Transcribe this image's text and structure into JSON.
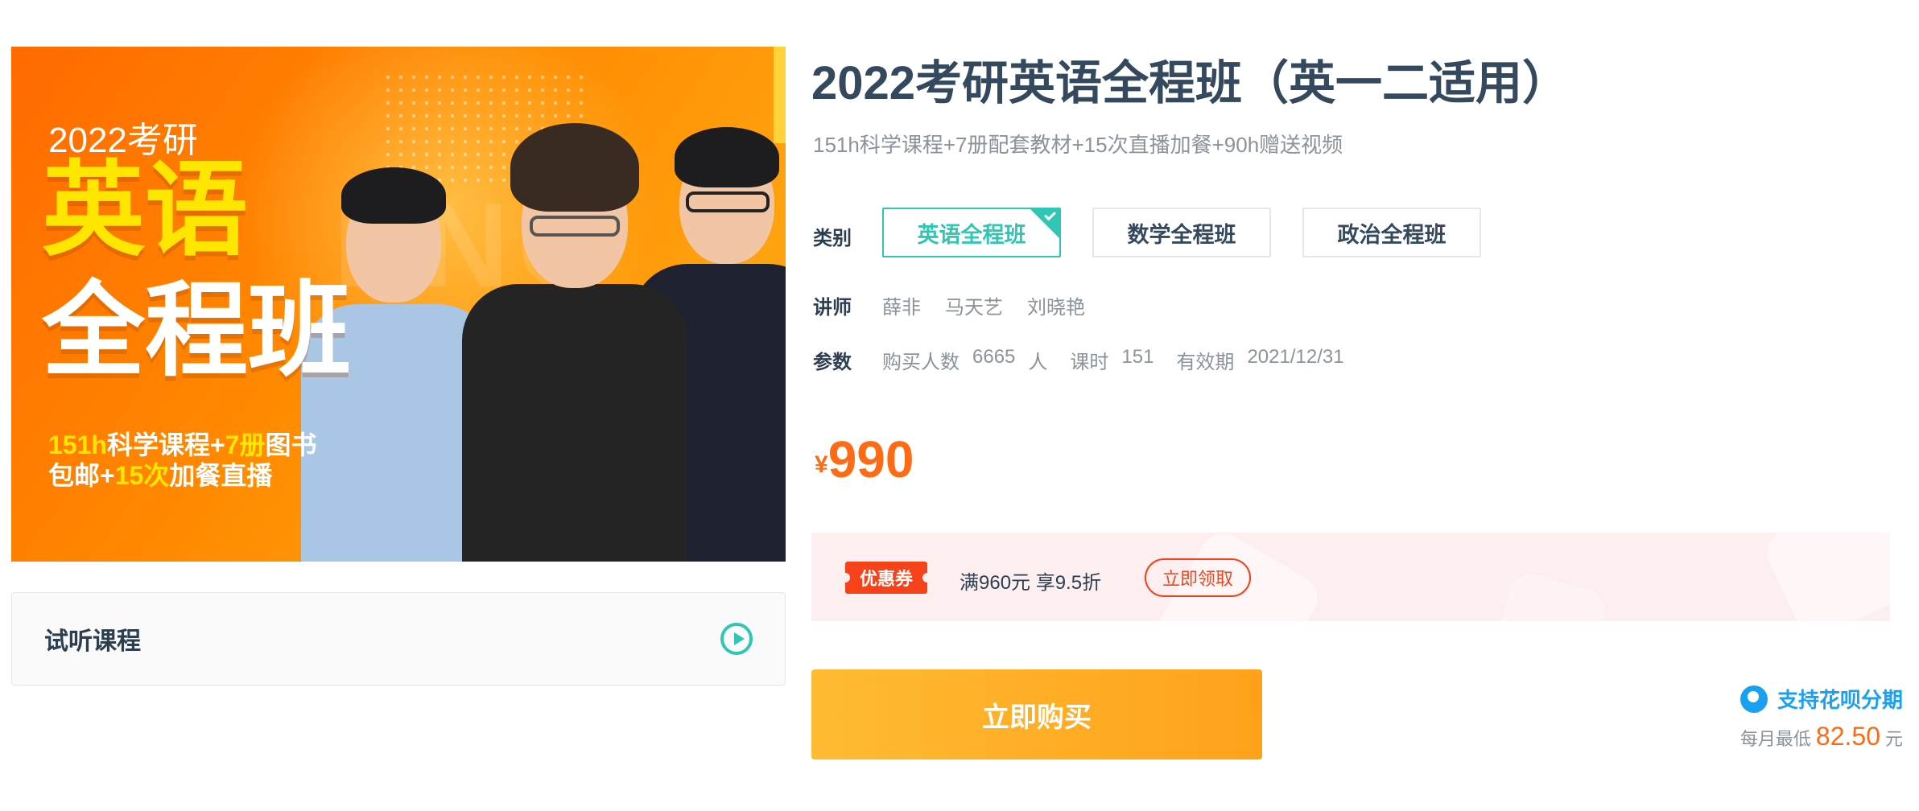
{
  "banner": {
    "year": "2022考研",
    "title_line1": "英语",
    "title_line2": "全程班",
    "line1_a": "151h",
    "line1_b": "科学课程+",
    "line1_c": "7册",
    "line1_d": "图书",
    "line2_a": "包邮+",
    "line2_b": "15次",
    "line2_c": "加餐直播"
  },
  "trial": {
    "label": "试听课程",
    "icon": "play-circle-icon"
  },
  "product": {
    "title": "2022考研英语全程班（英一二适用）",
    "subtitle": "151h科学课程+7册配套教材+15次直播加餐+90h赠送视频"
  },
  "category": {
    "label": "类别",
    "options": [
      {
        "label": "英语全程班",
        "selected": true
      },
      {
        "label": "数学全程班",
        "selected": false
      },
      {
        "label": "政治全程班",
        "selected": false
      }
    ]
  },
  "teachers": {
    "label": "讲师",
    "names": [
      "薛非",
      "马天艺",
      "刘晓艳"
    ]
  },
  "params": {
    "label": "参数",
    "buyers_label": "购买人数",
    "buyers_value": "6665",
    "buyers_unit": "人",
    "hours_label": "课时",
    "hours_value": "151",
    "validity_label": "有效期",
    "validity_value": "2021/12/31"
  },
  "price": {
    "currency": "¥",
    "value": "990"
  },
  "coupon": {
    "tag": "优惠券",
    "desc": "满960元 享9.5折",
    "claim_label": "立即领取"
  },
  "buy": {
    "label": "立即购买"
  },
  "huabei": {
    "label": "支持花呗分期",
    "monthly_prefix": "每月最低",
    "monthly_amount": "82.50",
    "monthly_unit": "元"
  },
  "colors": {
    "accent": "#2fc6b4",
    "price": "#ff6a14",
    "coupon": "#f5421a",
    "buy": "#ffa21a",
    "huabei": "#1aa0f0"
  }
}
